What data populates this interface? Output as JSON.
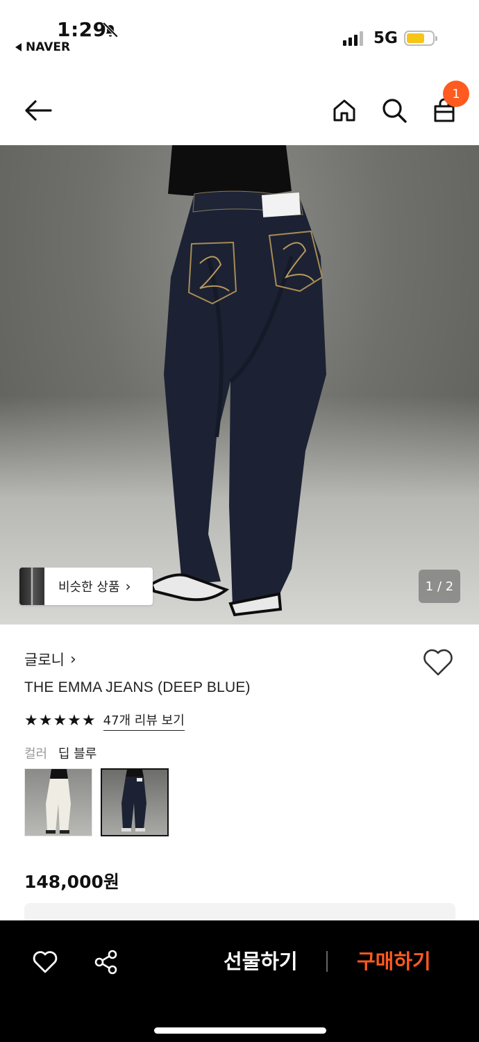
{
  "status_bar": {
    "time": "1:29",
    "back_app": "NAVER",
    "network": "5G",
    "icons": [
      "bell-off-icon",
      "signal-icon",
      "battery-icon"
    ],
    "battery_level": 0.7,
    "battery_color": "#f5c518"
  },
  "header": {
    "icons": [
      "back-arrow-icon",
      "home-icon",
      "search-icon",
      "shopping-bag-icon"
    ],
    "cart_count": "1",
    "badge_color": "#ff5a1f"
  },
  "hero": {
    "similar_label": "비슷한 상품",
    "page_indicator": "1 / 2"
  },
  "product": {
    "brand": "글로니",
    "name": "THE EMMA JEANS (DEEP BLUE)",
    "rating_stars": 5,
    "review_link": "47개 리뷰 보기",
    "color_label": "컬러",
    "color_value": "딥 블루",
    "swatches": [
      {
        "name": "white-jeans",
        "selected": false
      },
      {
        "name": "deep-blue-jeans",
        "selected": true
      }
    ],
    "price": "148,000원"
  },
  "bottom_bar": {
    "icons": [
      "heart-icon",
      "share-icon"
    ],
    "gift_label": "선물하기",
    "buy_label": "구매하기",
    "buy_color": "#ff5a1f"
  }
}
